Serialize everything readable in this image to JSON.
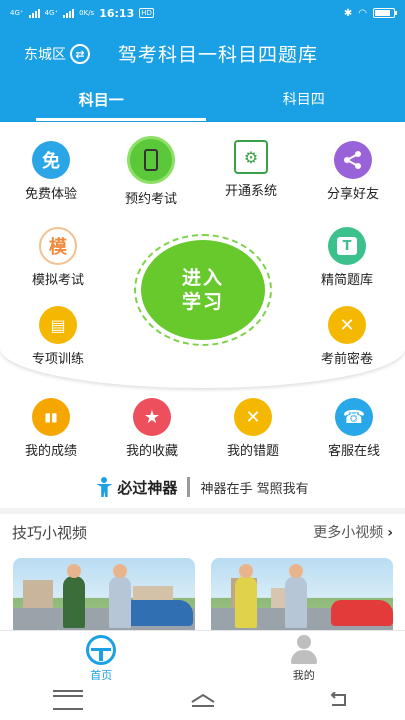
{
  "status_bar": {
    "net1": "4G⁺",
    "net2": "4G⁺",
    "speed": "0K/s",
    "time": "16:13",
    "sim_badge": "HD",
    "battery_level": 0.85
  },
  "header": {
    "city": "东城区",
    "swap_icon": "⇄",
    "title": "驾考科目一科目四题库"
  },
  "tabs": [
    {
      "label": "科目一",
      "active": true
    },
    {
      "label": "科目四",
      "active": false
    }
  ],
  "top_row": [
    {
      "label": "免费体验",
      "icon_text": "免",
      "color": "#2aa6e6"
    },
    {
      "label": "预约考试",
      "icon_text": "▯",
      "color": "#5bc83a"
    },
    {
      "label": "开通系统",
      "icon_text": "⚙",
      "color": "#ffffff"
    },
    {
      "label": "分享好友",
      "icon_text": "<",
      "color": "#9a62d8"
    }
  ],
  "side_buttons": [
    {
      "label": "模拟考试",
      "icon_text": "模",
      "color": "#f08a3c"
    },
    {
      "label": "精简题库",
      "icon_text": "T",
      "color": "#3cc08c"
    },
    {
      "label": "专项训练",
      "icon_text": "▤",
      "color": "#f5b800"
    },
    {
      "label": "考前密卷",
      "icon_text": "✕",
      "color": "#f5b800"
    }
  ],
  "center_button": {
    "line1": "进入",
    "line2": "学习"
  },
  "mid_row": [
    {
      "label": "我的成绩",
      "icon_text": "▮▮",
      "color": "#f5a700"
    },
    {
      "label": "我的收藏",
      "icon_text": "★",
      "color": "#ee4f5c"
    },
    {
      "label": "我的错题",
      "icon_text": "✕",
      "color": "#f5b800"
    },
    {
      "label": "客服在线",
      "icon_text": "☎",
      "color": "#28a8e8"
    }
  ],
  "slogan": {
    "main": "必过神器",
    "sub": "神器在手  驾照我有"
  },
  "videos": {
    "title": "技巧小视频",
    "more": "更多小视频",
    "more_icon": "›"
  },
  "bottom_nav": [
    {
      "label": "首页",
      "active": true
    },
    {
      "label": "我的",
      "active": false
    }
  ]
}
